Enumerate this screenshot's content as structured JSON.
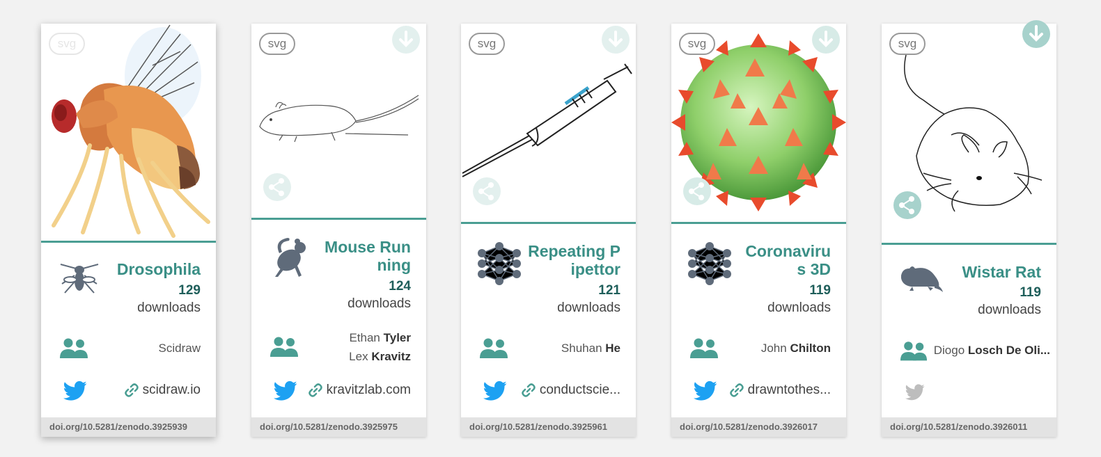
{
  "cards": [
    {
      "badge": "svg",
      "title": "Drosophila",
      "downloads": "129",
      "downloads_label": "downloads",
      "author_plain": "Scidraw",
      "link": "scidraw.io",
      "doi": "doi.org/10.5281/zenodo.3925939",
      "category_icon": "fly-icon",
      "twitter_color": "#1da1f2"
    },
    {
      "badge": "svg",
      "title": "Mouse Running",
      "downloads": "124",
      "downloads_label": "downloads",
      "authors": [
        {
          "first": "Ethan",
          "last": "Tyler"
        },
        {
          "first": "Lex",
          "last": "Kravitz"
        }
      ],
      "link": "kravitzlab.com",
      "doi": "doi.org/10.5281/zenodo.3925975",
      "category_icon": "running-mouse-icon",
      "twitter_color": "#1da1f2"
    },
    {
      "badge": "svg",
      "title": "Repeating Pipettor",
      "downloads": "121",
      "downloads_label": "downloads",
      "authors": [
        {
          "first": "Shuhan",
          "last": "He"
        }
      ],
      "link": "conductscie...",
      "doi": "doi.org/10.5281/zenodo.3925961",
      "category_icon": "network-icon",
      "twitter_color": "#1da1f2"
    },
    {
      "badge": "svg",
      "title": "Coronavirus 3D",
      "downloads": "119",
      "downloads_label": "downloads",
      "authors": [
        {
          "first": "John",
          "last": "Chilton"
        }
      ],
      "link": "drawntothes...",
      "doi": "doi.org/10.5281/zenodo.3926017",
      "category_icon": "network-icon",
      "twitter_color": "#1da1f2"
    },
    {
      "badge": "svg",
      "title": "Wistar Rat",
      "downloads": "119",
      "downloads_label": "downloads",
      "authors": [
        {
          "first": "Diogo",
          "last": "Losch De Oli..."
        }
      ],
      "doi": "doi.org/10.5281/zenodo.3926011",
      "category_icon": "rat-icon",
      "twitter_color": "#bdbdbd"
    }
  ],
  "colors": {
    "accent": "#4a9e93",
    "title": "#3a8f86",
    "icon_gray": "#5f6b7a",
    "twitter_blue": "#1da1f2"
  }
}
